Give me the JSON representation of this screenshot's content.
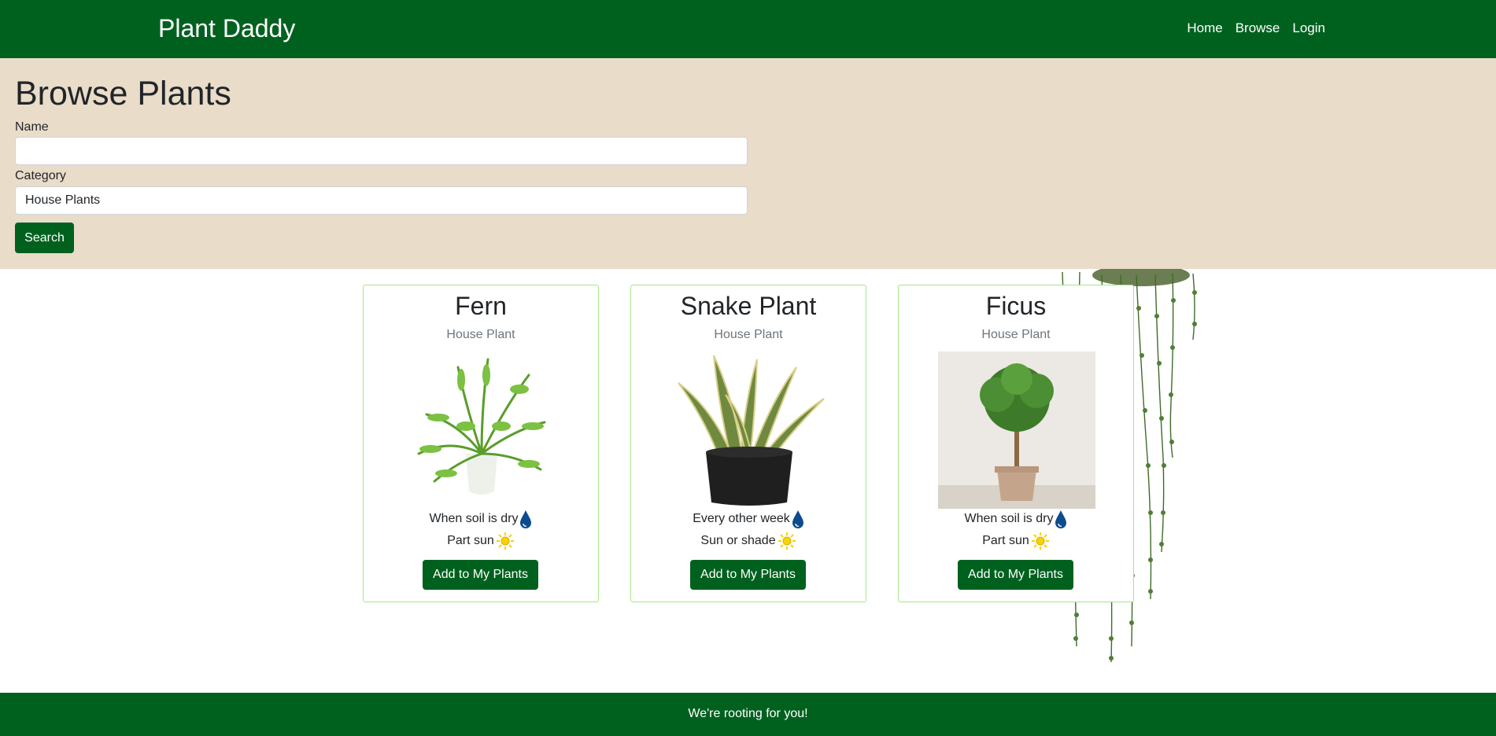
{
  "navbar": {
    "brand": "Plant Daddy",
    "links": [
      "Home",
      "Browse",
      "Login"
    ]
  },
  "search": {
    "title": "Browse Plants",
    "name_label": "Name",
    "name_value": "",
    "category_label": "Category",
    "category_value": "House Plants",
    "button_label": "Search"
  },
  "cards": [
    {
      "name": "Fern",
      "category": "House Plant",
      "water": "When soil is dry",
      "sun": "Part sun",
      "button_label": "Add to My Plants",
      "water_icon": "water-drop-icon",
      "sun_icon": "sun-icon"
    },
    {
      "name": "Snake Plant",
      "category": "House Plant",
      "water": "Every other week",
      "sun": "Sun or shade",
      "button_label": "Add to My Plants",
      "water_icon": "water-drop-icon",
      "sun_icon": "sun-icon"
    },
    {
      "name": "Ficus",
      "category": "House Plant",
      "water": "When soil is dry",
      "sun": "Part sun",
      "button_label": "Add to My Plants",
      "water_icon": "water-drop-icon",
      "sun_icon": "sun-icon"
    }
  ],
  "footer": {
    "text": "We're rooting for you!"
  },
  "colors": {
    "brand_green": "#00611f",
    "search_bg": "#e9dcc9",
    "card_border": "#a6e68b",
    "water_blue": "#0d4b8f",
    "sun_yellow": "#f5d400"
  }
}
